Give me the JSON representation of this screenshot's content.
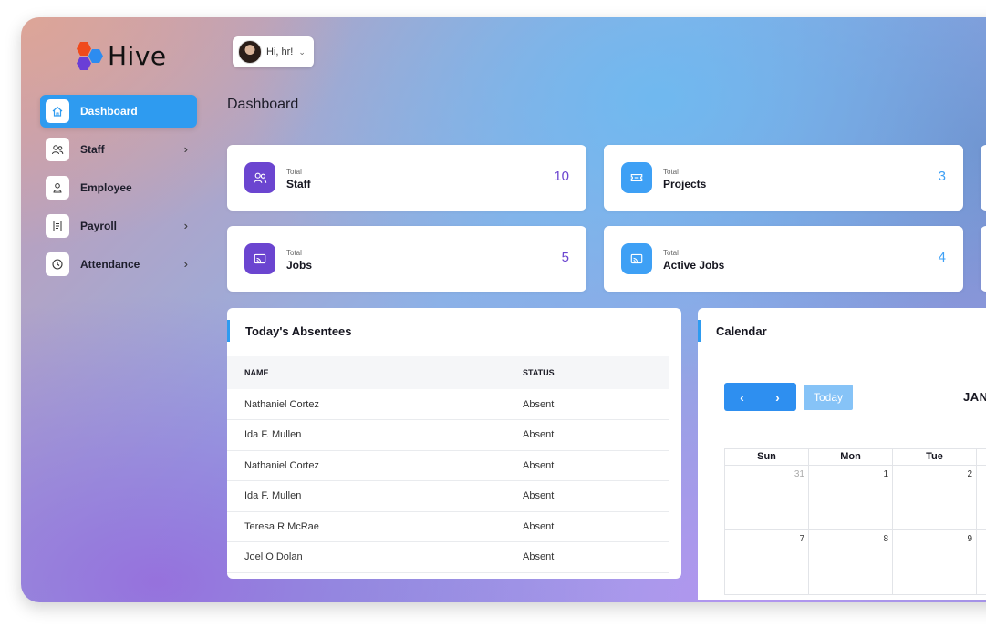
{
  "app": {
    "name": "Hive"
  },
  "user": {
    "greeting": "Hi, hr!"
  },
  "sidebar": {
    "items": [
      {
        "label": "Dashboard",
        "icon": "home-icon",
        "active": true,
        "has_chevron": false
      },
      {
        "label": "Staff",
        "icon": "users-icon",
        "active": false,
        "has_chevron": true
      },
      {
        "label": "Employee",
        "icon": "user-icon",
        "active": false,
        "has_chevron": false
      },
      {
        "label": "Payroll",
        "icon": "receipt-icon",
        "active": false,
        "has_chevron": true
      },
      {
        "label": "Attendance",
        "icon": "clock-icon",
        "active": false,
        "has_chevron": true
      }
    ]
  },
  "page": {
    "title": "Dashboard"
  },
  "stats": [
    {
      "sub": "Total",
      "label": "Staff",
      "value": "10",
      "icon": "users-icon",
      "color": "#6b45d0"
    },
    {
      "sub": "Total",
      "label": "Projects",
      "value": "3",
      "icon": "ticket-icon",
      "color": "#3ea0f5"
    },
    {
      "sub": "Total",
      "label": "Jobs",
      "value": "5",
      "icon": "cast-icon",
      "color": "#6b45d0"
    },
    {
      "sub": "Total",
      "label": "Active Jobs",
      "value": "4",
      "icon": "cast-icon",
      "color": "#3ea0f5"
    }
  ],
  "absentees": {
    "title": "Today's Absentees",
    "columns": [
      "NAME",
      "STATUS"
    ],
    "rows": [
      [
        "Nathaniel Cortez",
        "Absent"
      ],
      [
        "Ida F. Mullen",
        "Absent"
      ],
      [
        "Nathaniel Cortez",
        "Absent"
      ],
      [
        "Ida F. Mullen",
        "Absent"
      ],
      [
        "Teresa R McRae",
        "Absent"
      ],
      [
        "Joel O Dolan",
        "Absent"
      ]
    ]
  },
  "calendar": {
    "title": "Calendar",
    "today_label": "Today",
    "month_label": "JANU",
    "weekdays": [
      "Sun",
      "Mon",
      "Tue"
    ],
    "weeks": [
      [
        "31",
        "1",
        "2"
      ],
      [
        "7",
        "8",
        "9"
      ]
    ]
  },
  "colors": {
    "accent": "#2e9bf0",
    "purple": "#6b45d0",
    "blue": "#3ea0f5"
  }
}
